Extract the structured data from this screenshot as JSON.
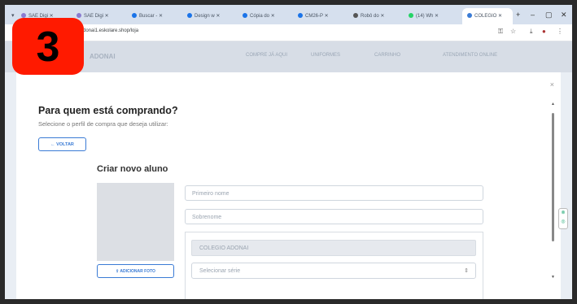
{
  "browser": {
    "tabs": [
      {
        "label": "SAE Digi",
        "color": "#8a7cd1"
      },
      {
        "label": "SAE Digi",
        "color": "#8a7cd1"
      },
      {
        "label": "Buscar -",
        "color": "#1a73e8"
      },
      {
        "label": "Design w",
        "color": "#1a73e8"
      },
      {
        "label": "Cópia do",
        "color": "#1a73e8"
      },
      {
        "label": "CM26-P",
        "color": "#1a73e8"
      },
      {
        "label": "Robô do",
        "color": "#555555"
      },
      {
        "label": "(14) Wh",
        "color": "#25d366"
      },
      {
        "label": "COLEGIO",
        "color": "#3a7bd5"
      }
    ],
    "new_tab": "+",
    "minimize": "–",
    "restore": "▢",
    "close_window": "✕",
    "url": "donai1.eskolare.shop/loja",
    "icons": [
      "key-icon",
      "star-icon",
      "download-icon",
      "profile-icon",
      "menu-icon"
    ]
  },
  "background_nav": {
    "brand": "ADONAI",
    "items": [
      "COMPRE JÁ AQUI",
      "UNIFORMES",
      "CARRINHO",
      "ATENDIMENTO ONLINE"
    ]
  },
  "step_badge": "3",
  "modal": {
    "close": "×",
    "title": "Para quem está comprando?",
    "subtitle": "Selecione o perfil de compra que deseja utilizar:",
    "back_button": "← VOLTAR",
    "section_title": "Criar novo aluno",
    "photo_button": "⇪ ADICIONAR FOTO",
    "fields": {
      "first_name_placeholder": "Primeiro nome",
      "last_name_placeholder": "Sobrenome",
      "school_value": "COLEGIO ADONAI",
      "grade_placeholder": "Selecionar série"
    }
  },
  "colors": {
    "accent": "#3a7bd5",
    "badge": "#ff1a00"
  }
}
